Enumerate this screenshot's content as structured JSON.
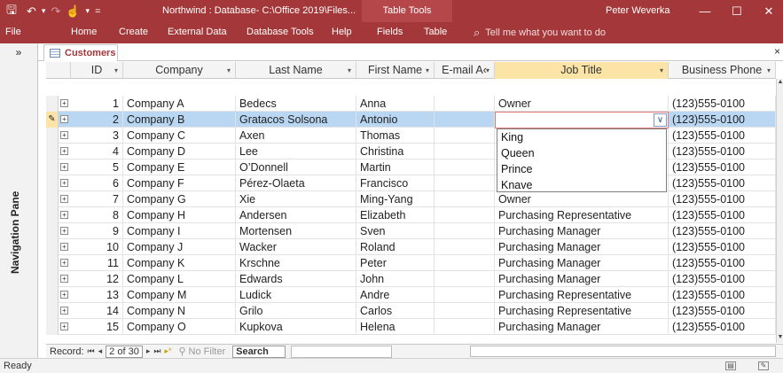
{
  "titlebar": {
    "title": "Northwind : Database- C:\\Office 2019\\Files...",
    "context_tab": "Table Tools",
    "user": "Peter Weverka",
    "save_glyph": "🖫",
    "undo_glyph": "↶",
    "redo_glyph": "↷",
    "touch_glyph": "☝",
    "qat_more_glyph": "▾",
    "min_glyph": "—",
    "max_glyph": "☐",
    "close_glyph": "✕"
  },
  "ribbon": {
    "tabs": [
      "File",
      "Home",
      "Create",
      "External Data",
      "Database Tools",
      "Help",
      "Fields",
      "Table"
    ],
    "tell_me": "Tell me what you want to do",
    "tell_icon": "⌕"
  },
  "nav": {
    "toggle": "»",
    "label": "Navigation Pane"
  },
  "doc": {
    "tab_label": "Customers",
    "close": "×"
  },
  "grid": {
    "columns": [
      {
        "label": "ID",
        "arrow": "▾"
      },
      {
        "label": "Company",
        "arrow": "▾"
      },
      {
        "label": "Last Name",
        "arrow": "▾"
      },
      {
        "label": "First Name",
        "arrow": "▾"
      },
      {
        "label": "E-mail A‹",
        "arrow": "▾"
      },
      {
        "label": "Job Title",
        "arrow": "▾"
      },
      {
        "label": "Business Phone",
        "arrow": "▾"
      }
    ],
    "rows": [
      {
        "id": "1",
        "company": "Company A",
        "last": "Bedecs",
        "first": "Anna",
        "email": "",
        "job": "Owner",
        "phone": "(123)555-0100"
      },
      {
        "id": "2",
        "company": "Company B",
        "last": "Gratacos Solsona",
        "first": "Antonio",
        "email": "",
        "job": "",
        "phone": "(123)555-0100"
      },
      {
        "id": "3",
        "company": "Company C",
        "last": "Axen",
        "first": "Thomas",
        "email": "",
        "job": "",
        "phone": "(123)555-0100"
      },
      {
        "id": "4",
        "company": "Company D",
        "last": "Lee",
        "first": "Christina",
        "email": "",
        "job": "",
        "phone": "(123)555-0100"
      },
      {
        "id": "5",
        "company": "Company E",
        "last": "O’Donnell",
        "first": "Martin",
        "email": "",
        "job": "",
        "phone": "(123)555-0100"
      },
      {
        "id": "6",
        "company": "Company F",
        "last": "Pérez-Olaeta",
        "first": "Francisco",
        "email": "",
        "job": "",
        "phone": "(123)555-0100"
      },
      {
        "id": "7",
        "company": "Company G",
        "last": "Xie",
        "first": "Ming-Yang",
        "email": "",
        "job": "Owner",
        "phone": "(123)555-0100"
      },
      {
        "id": "8",
        "company": "Company H",
        "last": "Andersen",
        "first": "Elizabeth",
        "email": "",
        "job": "Purchasing Representative",
        "phone": "(123)555-0100"
      },
      {
        "id": "9",
        "company": "Company I",
        "last": "Mortensen",
        "first": "Sven",
        "email": "",
        "job": "Purchasing Manager",
        "phone": "(123)555-0100"
      },
      {
        "id": "10",
        "company": "Company J",
        "last": "Wacker",
        "first": "Roland",
        "email": "",
        "job": "Purchasing Manager",
        "phone": "(123)555-0100"
      },
      {
        "id": "11",
        "company": "Company K",
        "last": "Krschne",
        "first": "Peter",
        "email": "",
        "job": "Purchasing Manager",
        "phone": "(123)555-0100"
      },
      {
        "id": "12",
        "company": "Company L",
        "last": "Edwards",
        "first": "John",
        "email": "",
        "job": "Purchasing Manager",
        "phone": "(123)555-0100"
      },
      {
        "id": "13",
        "company": "Company M",
        "last": "Ludick",
        "first": "Andre",
        "email": "",
        "job": "Purchasing Representative",
        "phone": "(123)555-0100"
      },
      {
        "id": "14",
        "company": "Company N",
        "last": "Grilo",
        "first": "Carlos",
        "email": "",
        "job": "Purchasing Representative",
        "phone": "(123)555-0100"
      },
      {
        "id": "15",
        "company": "Company O",
        "last": "Kupkova",
        "first": "Helena",
        "email": "",
        "job": "Purchasing Manager",
        "phone": "(123)555-0100"
      }
    ],
    "expand_glyph": "+",
    "edit_glyph": "✎"
  },
  "combo": {
    "value": "",
    "button_glyph": "∨",
    "options": [
      "King",
      "Queen",
      "Prince",
      "Knave"
    ]
  },
  "recnav": {
    "label": "Record:",
    "first": "⏮",
    "prev": "◂",
    "position": "2 of 30",
    "next": "▸",
    "last": "⏭",
    "new": "▸*",
    "no_filter": "No Filter",
    "filter_icon": "⚲",
    "search": "Search"
  },
  "status": {
    "text": "Ready"
  }
}
